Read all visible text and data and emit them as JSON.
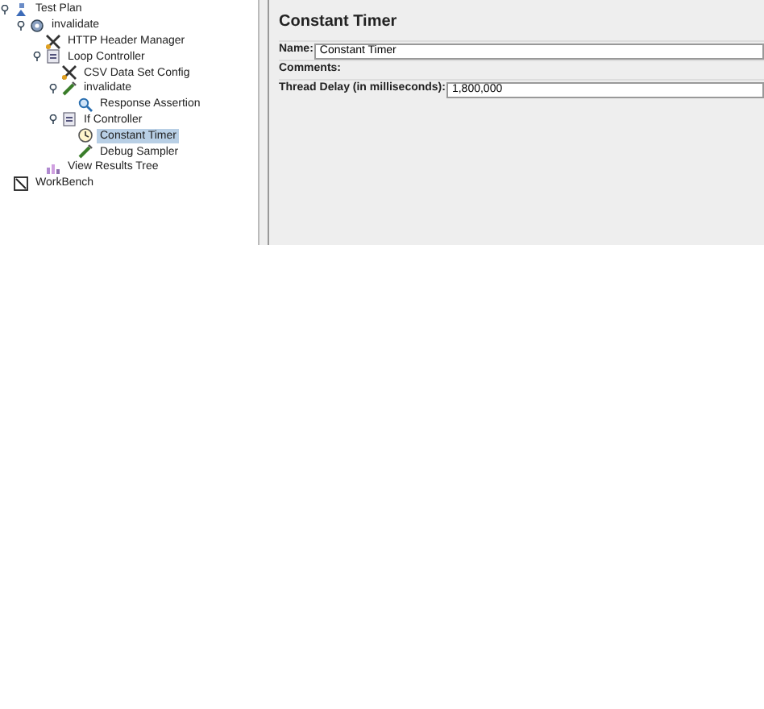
{
  "tree": [
    {
      "label": "Test Plan",
      "kind": "plan",
      "selected": false,
      "expanded": true,
      "children": [
        {
          "label": "invalidate",
          "kind": "threads",
          "selected": false,
          "expanded": true,
          "children": [
            {
              "label": "HTTP Header Manager",
              "kind": "config",
              "selected": false
            },
            {
              "label": "Loop Controller",
              "kind": "controller",
              "selected": false,
              "expanded": true,
              "children": [
                {
                  "label": "CSV Data Set Config",
                  "kind": "config",
                  "selected": false
                },
                {
                  "label": "invalidate",
                  "kind": "sampler",
                  "selected": false,
                  "expanded": true,
                  "children": [
                    {
                      "label": "Response Assertion",
                      "kind": "assertion",
                      "selected": false
                    }
                  ]
                },
                {
                  "label": "If Controller",
                  "kind": "controller",
                  "selected": false,
                  "expanded": true,
                  "children": [
                    {
                      "label": "Constant Timer",
                      "kind": "timer",
                      "selected": true
                    },
                    {
                      "label": "Debug Sampler",
                      "kind": "sampler",
                      "selected": false
                    }
                  ]
                }
              ]
            },
            {
              "label": "View Results Tree",
              "kind": "listener",
              "selected": false
            }
          ]
        }
      ]
    },
    {
      "label": "WorkBench",
      "kind": "workbench",
      "selected": false
    }
  ],
  "panel": {
    "title": "Constant Timer",
    "fields": [
      {
        "label": "Name:",
        "value": "Constant Timer"
      },
      {
        "label": "Comments:"
      },
      {
        "label": "Thread Delay (in milliseconds):",
        "value": "1,800,000"
      }
    ]
  }
}
